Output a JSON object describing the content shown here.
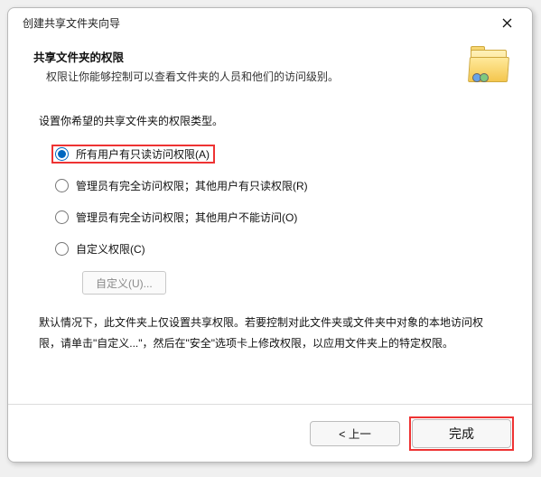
{
  "window": {
    "title": "创建共享文件夹向导"
  },
  "header": {
    "title": "共享文件夹的权限",
    "desc": "权限让你能够控制可以查看文件夹的人员和他们的访问级别。"
  },
  "content": {
    "instruction": "设置你希望的共享文件夹的权限类型。",
    "options": {
      "all_read": "所有用户有只读访问权限(A)",
      "admin_full_other_read": "管理员有完全访问权限；其他用户有只读权限(R)",
      "admin_full_other_none": "管理员有完全访问权限；其他用户不能访问(O)",
      "custom": "自定义权限(C)"
    },
    "custom_button": "自定义(U)...",
    "note": "默认情况下，此文件夹上仅设置共享权限。若要控制对此文件夹或文件夹中对象的本地访问权限，请单击\"自定义...\"，然后在\"安全\"选项卡上修改权限，以应用文件夹上的特定权限。"
  },
  "footer": {
    "back": "< 上一",
    "finish": "完成"
  }
}
